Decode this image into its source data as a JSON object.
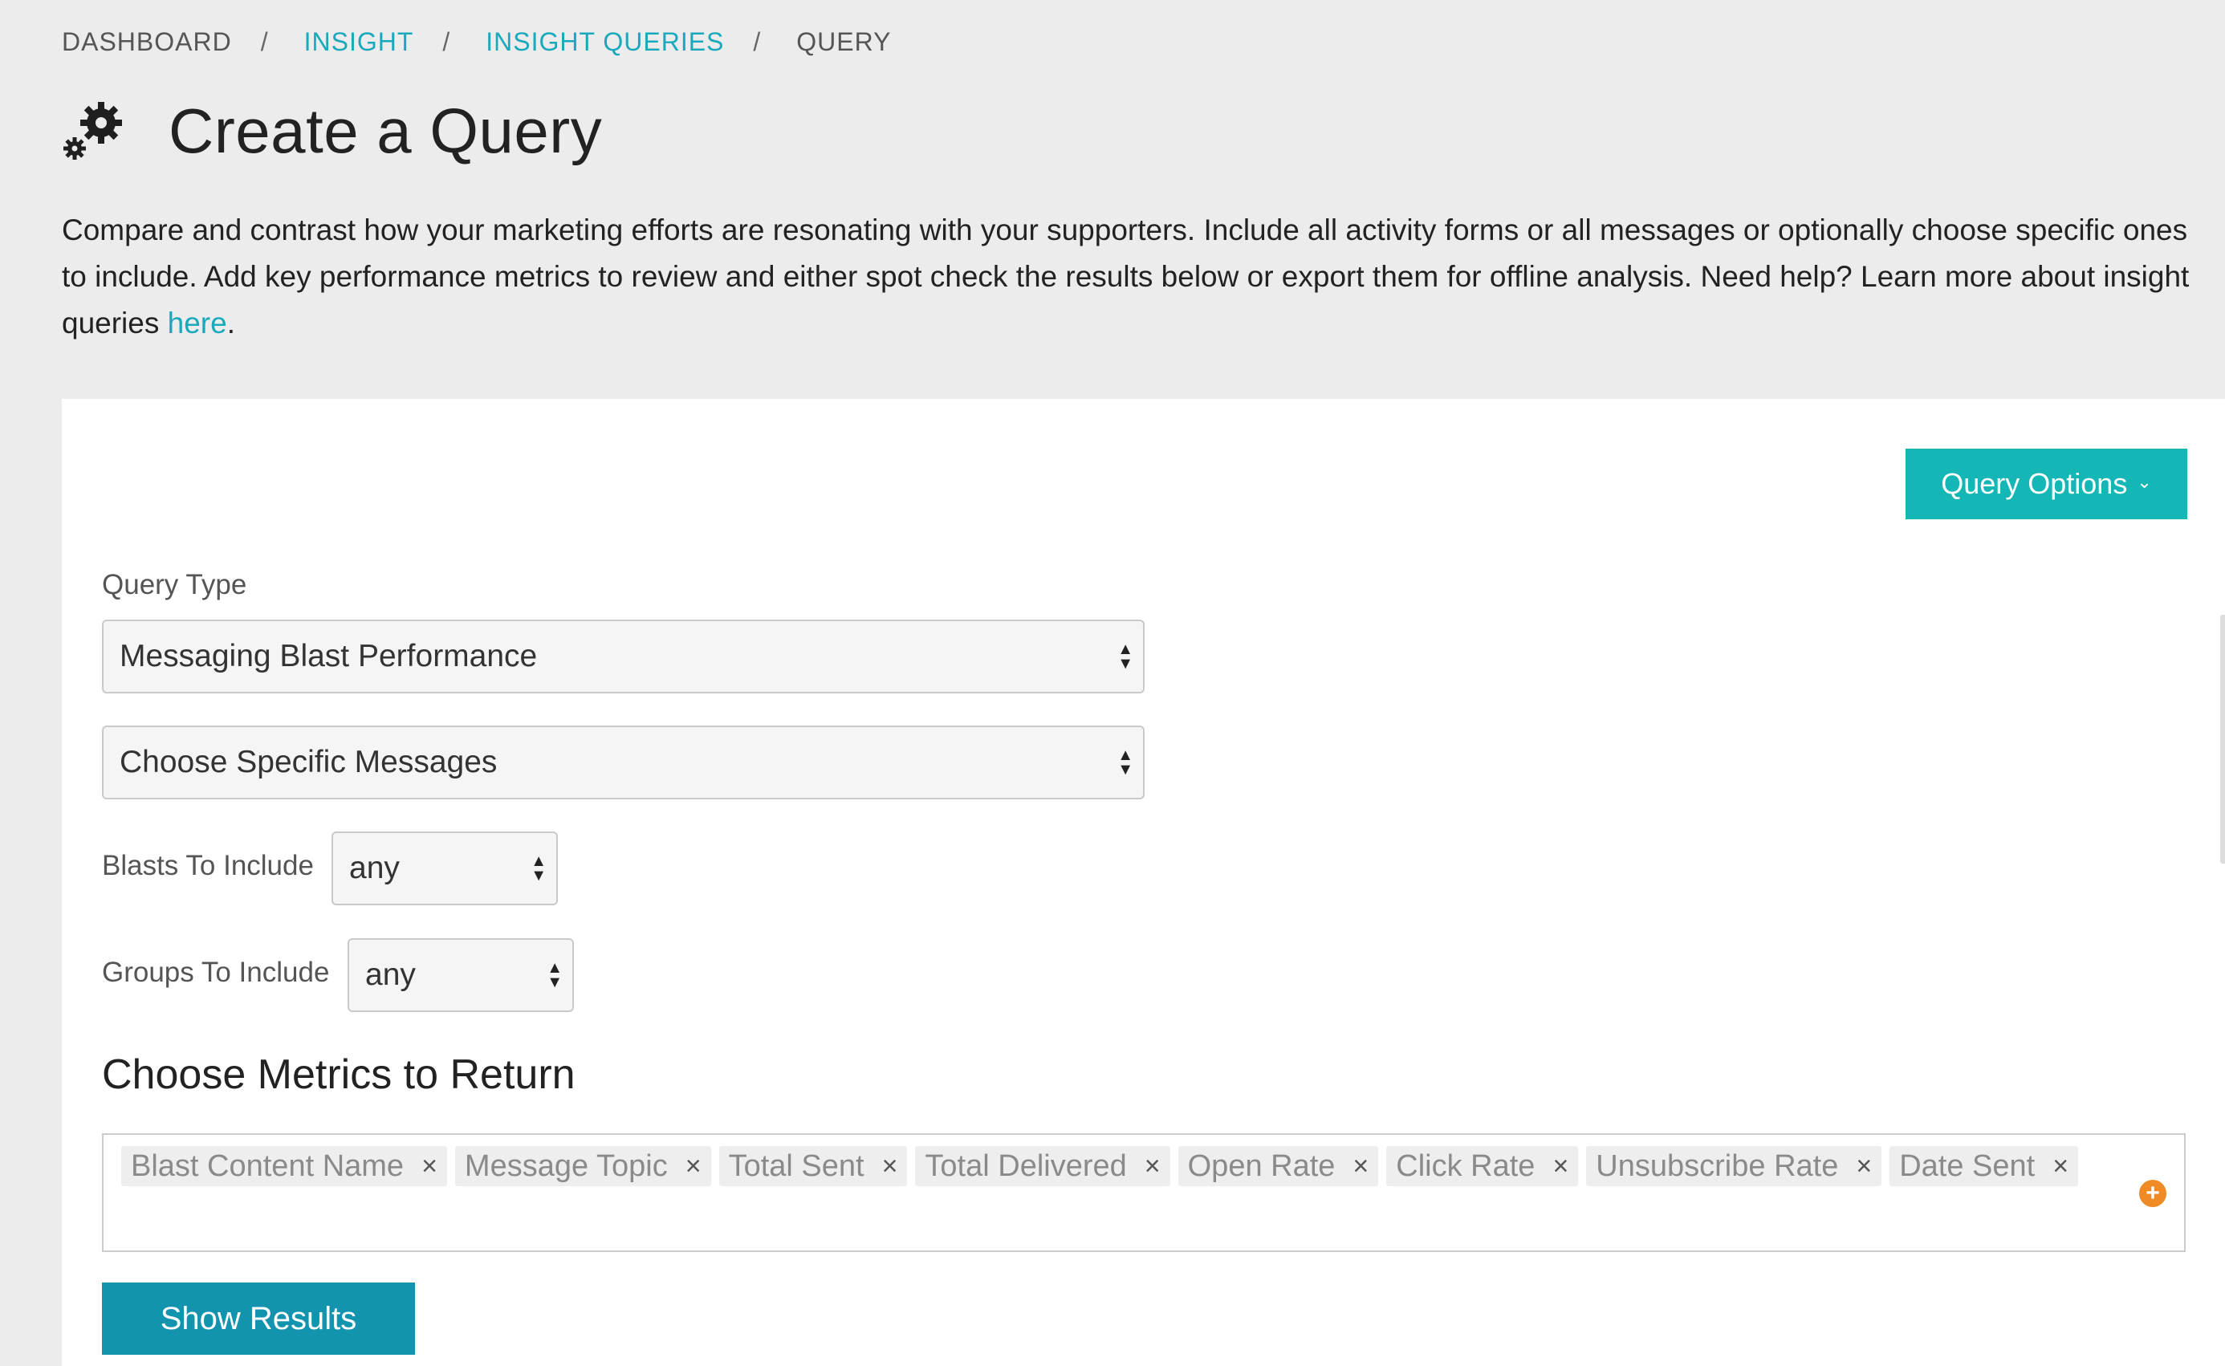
{
  "breadcrumb": {
    "items": [
      {
        "label": "DASHBOARD"
      },
      {
        "label": "INSIGHT"
      },
      {
        "label": "INSIGHT QUERIES"
      },
      {
        "label": "QUERY"
      }
    ],
    "separator": "/"
  },
  "header": {
    "icon": "gears-icon",
    "title": "Create a Query"
  },
  "intro": {
    "text": "Compare and contrast how your marketing efforts are resonating with your supporters. Include all activity forms or all messages or optionally choose specific ones to include. Add key performance metrics to review and either spot check the results below or export them for offline analysis. Need help? Learn more about insight queries ",
    "link_label": "here",
    "trailing": "."
  },
  "panel": {
    "query_options_label": "Query Options",
    "query_type": {
      "label": "Query Type",
      "value": "Messaging Blast Performance"
    },
    "message_scope": {
      "value": "Choose Specific Messages"
    },
    "blasts": {
      "label": "Blasts To Include",
      "value": "any"
    },
    "groups": {
      "label": "Groups To Include",
      "value": "any"
    },
    "metrics": {
      "title": "Choose Metrics to Return",
      "tags": [
        "Blast Content Name",
        "Message Topic",
        "Total Sent",
        "Total Delivered",
        "Open Rate",
        "Click Rate",
        "Unsubscribe Rate",
        "Date Sent"
      ],
      "remove_glyph": "×",
      "add_glyph": "+"
    },
    "show_results_label": "Show Results"
  },
  "colors": {
    "accent_teal": "#14b6b6",
    "link": "#19a9bc",
    "primary_button": "#1293ae",
    "add_icon": "#f08a24"
  }
}
